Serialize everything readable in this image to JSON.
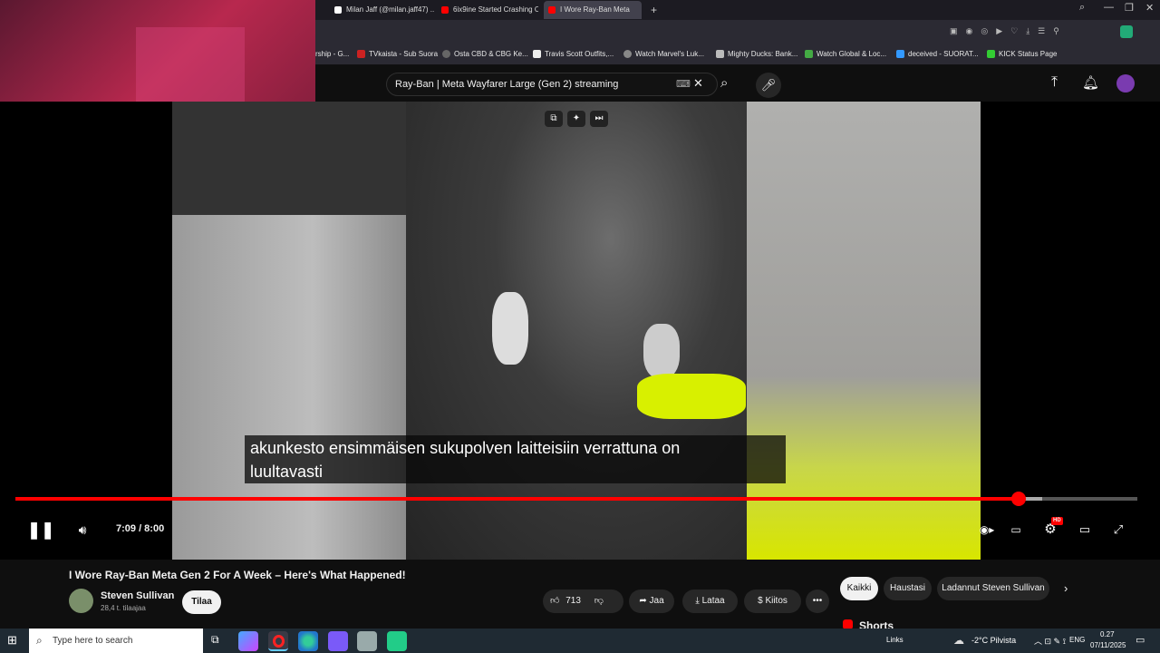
{
  "browser": {
    "tabs": [
      {
        "label": "Milan Jaff (@milan.jaff47) ..."
      },
      {
        "label": "6ix9ine Started Crashing O..."
      },
      {
        "label": "I Wore Ray-Ban Meta"
      }
    ],
    "bookmarks": [
      {
        "label": "rship - G..."
      },
      {
        "label": "TVkaista - Sub Suora"
      },
      {
        "label": "Osta CBD & CBG Ke..."
      },
      {
        "label": "Travis Scott Outfits,..."
      },
      {
        "label": "Watch Marvel's Luk..."
      },
      {
        "label": "Mighty Ducks: Bank..."
      },
      {
        "label": "Watch Global & Loc..."
      },
      {
        "label": "deceived - SUORAT..."
      },
      {
        "label": "KICK Status Page"
      }
    ]
  },
  "search": {
    "query": "Ray-Ban | Meta Wayfarer Large (Gen 2) streaming"
  },
  "player": {
    "caption_line1": "akunkesto ensimmäisen sukupolven laitteisiin verrattuna on",
    "caption_line2": "luultavasti",
    "time": "7:09 / 8:00",
    "progress": 0.894,
    "hd_badge": "HD"
  },
  "video": {
    "title": "I Wore Ray-Ban Meta Gen 2 For A Week – Here's What Happened!",
    "channel": "Steven Sullivan",
    "subscribers": "28,4 t. tilaajaa",
    "subscribe_label": "Tilaa",
    "likes": "713",
    "share_label": "Jaa",
    "download_label": "Lataa",
    "thanks_label": "Kiitos"
  },
  "filters": {
    "chips": [
      "Kaikki",
      "Haustasi",
      "Ladannut Steven Sullivan"
    ],
    "shorts_label": "Shorts"
  },
  "taskbar": {
    "search_placeholder": "Type here to search",
    "links_label": "Links",
    "weather": "-2°C  Pilvista",
    "lang": "ENG",
    "time": "0.27",
    "date": "07/11/2025"
  },
  "colors": {
    "accent": "#ff0000",
    "bg": "#0f0f0f"
  }
}
